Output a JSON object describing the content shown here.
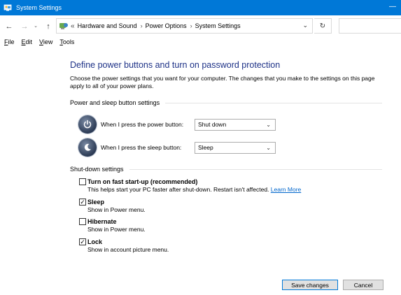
{
  "window": {
    "title": "System Settings",
    "minimize_glyph": "—"
  },
  "nav": {
    "back": "←",
    "forward": "→",
    "recent": "⌄",
    "up": "↑",
    "crumb_overflow": "«",
    "breadcrumbs": [
      "Hardware and Sound",
      "Power Options",
      "System Settings"
    ],
    "separator": "›",
    "dropdown": "⌄",
    "refresh": "↻"
  },
  "menu": {
    "items": [
      {
        "underline": "F",
        "rest": "ile"
      },
      {
        "underline": "E",
        "rest": "dit"
      },
      {
        "underline": "V",
        "rest": "iew"
      },
      {
        "underline": "T",
        "rest": "ools"
      }
    ]
  },
  "main": {
    "heading": "Define power buttons and turn on password protection",
    "description": "Choose the power settings that you want for your computer. The changes that you make to the settings on this page apply to all of your power plans."
  },
  "power_section": {
    "header": "Power and sleep button settings",
    "rows": [
      {
        "label": "When I press the power button:",
        "value": "Shut down",
        "icon": "power-icon"
      },
      {
        "label": "When I press the sleep button:",
        "value": "Sleep",
        "icon": "sleep-icon"
      }
    ],
    "caret": "⌄"
  },
  "shutdown_section": {
    "header": "Shut-down settings",
    "items": [
      {
        "label": "Turn on fast start-up (recommended)",
        "checked": false,
        "desc": "This helps start your PC faster after shut-down. Restart isn't affected.",
        "link": "Learn More"
      },
      {
        "label": "Sleep",
        "checked": true,
        "desc": "Show in Power menu."
      },
      {
        "label": "Hibernate",
        "checked": false,
        "desc": "Show in Power menu."
      },
      {
        "label": "Lock",
        "checked": true,
        "desc": "Show in account picture menu."
      }
    ],
    "check_glyph": "✓"
  },
  "footer": {
    "save": "Save changes",
    "cancel": "Cancel"
  },
  "colors": {
    "titlebar": "#0078d7",
    "heading": "#1e3287",
    "link": "#0066cc"
  }
}
